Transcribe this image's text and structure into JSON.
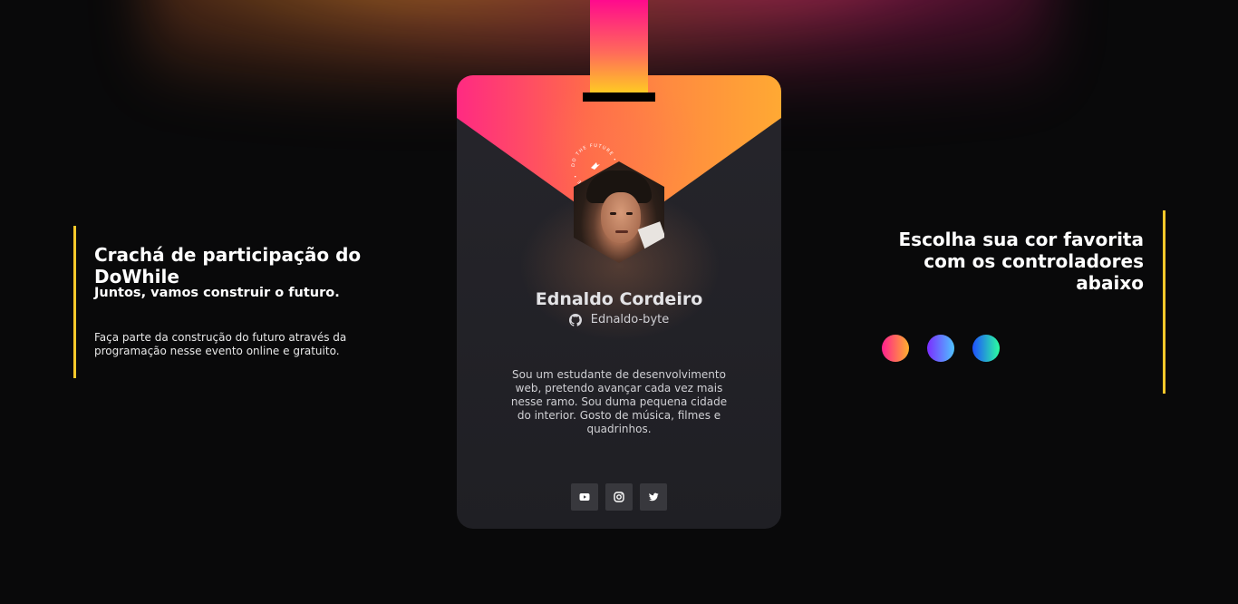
{
  "left": {
    "title": "Crachá de participação do DoWhile",
    "subtitle": "Juntos, vamos construir o futuro.",
    "description": "Faça parte da construção do futuro através da programação nesse evento online e gratuito."
  },
  "right": {
    "title": "Escolha sua cor favorita com os controladores abaixo",
    "swatches": [
      {
        "name": "pink-orange",
        "from": "#ff1f8f",
        "to": "#ffb02e"
      },
      {
        "name": "purple-blue",
        "from": "#7b2cff",
        "to": "#4fc3ff"
      },
      {
        "name": "blue-green",
        "from": "#1f4fff",
        "to": "#2bffa0"
      }
    ]
  },
  "badge": {
    "name": "Ednaldo Cordeiro",
    "github_user": "Ednaldo-byte",
    "github_icon": "github-icon",
    "bio": "Sou um estudante de desenvolvimento web, pretendo avançar cada vez mais nesse ramo. Sou duma pequena cidade do interior. Gosto de música, filmes e quadrinhos.",
    "ring_text": "DO THE FUTURE • DO THE FUTURE •",
    "socials": [
      "youtube-icon",
      "instagram-icon",
      "twitter-icon"
    ]
  },
  "colors": {
    "accent_yellow": "#ffc82a",
    "background": "#09090a",
    "badge_bg": "#1f1f24"
  }
}
